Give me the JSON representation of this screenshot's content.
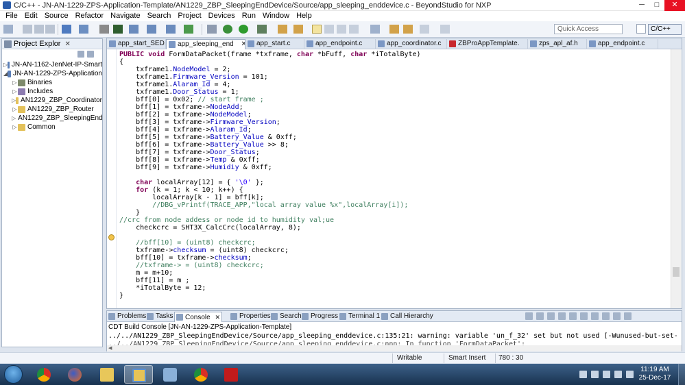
{
  "window": {
    "title": "C/C++ - JN-AN-1229-ZPS-Application-Template/AN1229_ZBP_SleepingEndDevice/Source/app_sleeping_enddevice.c - BeyondStudio for NXP",
    "minimize": "─",
    "maximize": "□",
    "close": "✕"
  },
  "menu": [
    "File",
    "Edit",
    "Source",
    "Refactor",
    "Navigate",
    "Search",
    "Project",
    "Devices",
    "Run",
    "Window",
    "Help"
  ],
  "quick_access": {
    "placeholder": "Quick Access"
  },
  "perspective": {
    "label": "C/C++"
  },
  "project_explorer": {
    "title": "Project Explor",
    "close": "✕",
    "items": [
      {
        "label": "JN-AN-1162-JenNet-IP-Smart",
        "arrow": "▷",
        "icon": "project-icon"
      },
      {
        "label": "JN-AN-1229-ZPS-Application",
        "arrow": "◢",
        "icon": "project-icon"
      },
      {
        "label": "Binaries",
        "arrow": "▷",
        "icon": "binaries-icon"
      },
      {
        "label": "Includes",
        "arrow": "▷",
        "icon": "includes-icon"
      },
      {
        "label": "AN1229_ZBP_Coordinator",
        "arrow": "▷",
        "icon": "folder-icon"
      },
      {
        "label": "AN1229_ZBP_Router",
        "arrow": "▷",
        "icon": "folder-icon"
      },
      {
        "label": "AN1229_ZBP_SleepingEnd",
        "arrow": "▷",
        "icon": "folder-icon"
      },
      {
        "label": "Common",
        "arrow": "▷",
        "icon": "folder-icon"
      }
    ]
  },
  "editor_tabs": [
    {
      "label": "app_start_SED.c"
    },
    {
      "label": "app_sleeping_end",
      "close": "✕"
    },
    {
      "label": "app_start.c"
    },
    {
      "label": "app_endpoint.c"
    },
    {
      "label": "app_coordinator.c"
    },
    {
      "label": "ZBProAppTemplate."
    },
    {
      "label": "zps_apl_af.h"
    },
    {
      "label": "app_endpoint.c"
    }
  ],
  "code_lines": [
    "PUBLIC void FormDataPacket(frame *txframe, char *bFuff, char *iTotalByte)",
    "{",
    "    txframe1.NodeModel = 2;",
    "    txframe1.Firmware_Version = 101;",
    "    txframe1.Alaram_Id = 4;",
    "    txframe1.Door_Status = 1;",
    "    bff[0] = 0x02; // start frame ;",
    "    bff[1] = txframe->NodeAdd;",
    "    bff[2] = txframe->NodeModel;",
    "    bff[3] = txframe->Firmware_Version;",
    "    bff[4] = txframe->Alaram_Id;",
    "    bff[5] = txframe->Battery_Value & 0xff;",
    "    bff[6] = txframe->Battery_Value >> 8;",
    "    bff[7] = txframe->Door_Status;",
    "    bff[8] = txframe->Temp & 0xff;",
    "    bff[9] = txframe->Humidiy & 0xff;",
    "",
    "    char localArray[12] = { '\\0' };",
    "    for (k = 1; k < 10; k++) {",
    "        localArray[k - 1] = bff[k];",
    "        //DBG_vPrintf(TRACE_APP,\"local array value %x\",localArray[i]);",
    "    }",
    "//crc from node addess or node id to humidity val;ue",
    "    checkcrc = SHT3X_CalcCrc(localArray, 8);",
    "",
    "    //bff[10] = (uint8) checkcrc;",
    "    txframe->checksum = (uint8) checkcrc;",
    "    bff[10] = txframe->checksum;",
    "    //txframe-> = (uint8) checkcrc;",
    "    m = m+10;",
    "    bff[11] = m ;",
    "    *iTotalByte = 12;",
    "}"
  ],
  "bottom_tabs": [
    "Problems",
    "Tasks",
    "Console",
    "Properties",
    "Search",
    "Progress",
    "Terminal 1",
    "Call Hierarchy"
  ],
  "console": {
    "title": "CDT Build Console [JN-AN-1229-ZPS-Application-Template]",
    "line": "../../AN1229_ZBP_SleepingEndDevice/Source/app_sleeping_enddevice.c:135:21: warning: variable 'un_f_32' set but not used [-Wunused-but-set-variable]",
    "line2": "../../AN1229_ZBP_SleepingEndDevice/Source/app_sleeping_enddevice.c:nnn: In function 'FormDataPacket':"
  },
  "status": {
    "writable": "Writable",
    "insert_mode": "Smart Insert",
    "position": "780 : 30"
  },
  "taskbar": {
    "apps": [
      "chrome-icon",
      "firefox-icon",
      "explorer-icon",
      "beyondstudio-icon",
      "virtualbox-icon",
      "chrome-icon",
      "acrobat-icon"
    ],
    "time": "11:19 AM",
    "date": "25-Dec-17"
  },
  "colors": {
    "keyword": "#7f0055",
    "field": "#0000c0",
    "comment": "#3f7f5f",
    "string": "#2a00ff",
    "selection_tab": "#ffffff",
    "taskbar": "#1c3a5e"
  }
}
